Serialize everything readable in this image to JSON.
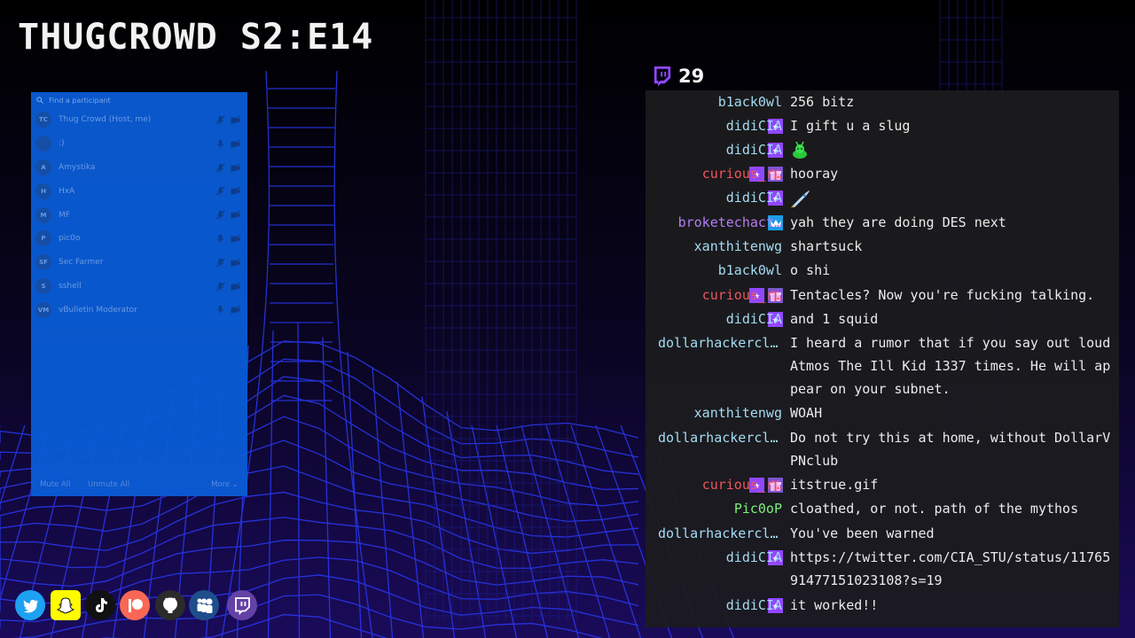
{
  "show_title": "THUGCROWD S2:E14",
  "participants": {
    "search_placeholder": "Find a participant",
    "items": [
      {
        "initials": "TC",
        "name": "Thug Crowd (Host, me)",
        "mic_muted": true
      },
      {
        "initials": "",
        "name": ":)",
        "mic_muted": false
      },
      {
        "initials": "A",
        "name": "Amystika",
        "mic_muted": true
      },
      {
        "initials": "H",
        "name": "HxA",
        "mic_muted": true
      },
      {
        "initials": "M",
        "name": "MF",
        "mic_muted": true
      },
      {
        "initials": "P",
        "name": "pic0o",
        "mic_muted": false
      },
      {
        "initials": "SF",
        "name": "Sec Farmer",
        "mic_muted": true
      },
      {
        "initials": "S",
        "name": "sshell",
        "mic_muted": true
      },
      {
        "initials": "VM",
        "name": "vBulletin Moderator",
        "mic_muted": false
      }
    ],
    "footer": {
      "mute_all": "Mute All",
      "unmute_all": "Unmute All",
      "more": "More ⌄"
    }
  },
  "chat": {
    "viewer_count": "29",
    "messages": [
      {
        "user": "b1ack0wl",
        "color": "#a4dcf2",
        "badges": [],
        "text": "256 bitz"
      },
      {
        "user": "didiCIA",
        "color": "#a4dcf2",
        "badges": [
          "star"
        ],
        "text": "I gift u a slug"
      },
      {
        "user": "didiCIA",
        "color": "#a4dcf2",
        "badges": [
          "star"
        ],
        "text": "",
        "emote": "slug"
      },
      {
        "user": "curious_r…",
        "color": "#f0555a",
        "badges": [
          "star",
          "gift"
        ],
        "text": "hooray"
      },
      {
        "user": "didiCIA",
        "color": "#a4dcf2",
        "badges": [
          "star"
        ],
        "text": "",
        "emote": "rocket"
      },
      {
        "user": "broketechact…",
        "color": "#b57cf0",
        "badges": [
          "crown"
        ],
        "text": "yah they are doing DES next"
      },
      {
        "user": "xanthitenwg",
        "color": "#a4dcf2",
        "badges": [],
        "text": "shartsuck"
      },
      {
        "user": "b1ack0wl",
        "color": "#a4dcf2",
        "badges": [],
        "text": "o shi"
      },
      {
        "user": "curious_r…",
        "color": "#f0555a",
        "badges": [
          "star",
          "gift"
        ],
        "text": "Tentacles? Now you're fucking talking."
      },
      {
        "user": "didiCIA",
        "color": "#a4dcf2",
        "badges": [
          "star"
        ],
        "text": "and 1 squid"
      },
      {
        "user": "dollarhackerclub",
        "color": "#a4dcf2",
        "badges": [],
        "text": "I heard a rumor that if you say out loud Atmos The Ill Kid 1337 times. He will appear on your subnet."
      },
      {
        "user": "xanthitenwg",
        "color": "#a4dcf2",
        "badges": [],
        "text": "WOAH"
      },
      {
        "user": "dollarhackerclub",
        "color": "#a4dcf2",
        "badges": [],
        "text": "Do not try this at home, without DollarVPNclub"
      },
      {
        "user": "curious_r…",
        "color": "#f0555a",
        "badges": [
          "star",
          "gift"
        ],
        "text": "itstrue.gif"
      },
      {
        "user": "Pic0oP",
        "color": "#7cf07c",
        "badges": [],
        "text": "cloathed, or not. path of the mythos"
      },
      {
        "user": "dollarhackerclub",
        "color": "#a4dcf2",
        "badges": [],
        "text": "You've been warned"
      },
      {
        "user": "didiCIA",
        "color": "#a4dcf2",
        "badges": [
          "star"
        ],
        "text": "https://twitter.com/CIA_STU/status/1176591477151023108?s=19"
      },
      {
        "user": "didiCIA",
        "color": "#a4dcf2",
        "badges": [
          "star"
        ],
        "text": "it worked!!"
      }
    ]
  },
  "socials": [
    {
      "icon": "twitter-icon",
      "color": "#1da1f2"
    },
    {
      "icon": "snapchat-icon",
      "color": "#fffc00"
    },
    {
      "icon": "tiktok-icon",
      "color": "#111111"
    },
    {
      "icon": "patreon-icon",
      "color": "#f96854"
    },
    {
      "icon": "github-icon",
      "color": "#2b2b2b"
    },
    {
      "icon": "myspace-icon",
      "color": "#1e4e8c"
    },
    {
      "icon": "twitch-icon",
      "color": "#6441a5"
    }
  ],
  "colors": {
    "accent": "#9147ff",
    "panel": "#0a5cd6"
  }
}
